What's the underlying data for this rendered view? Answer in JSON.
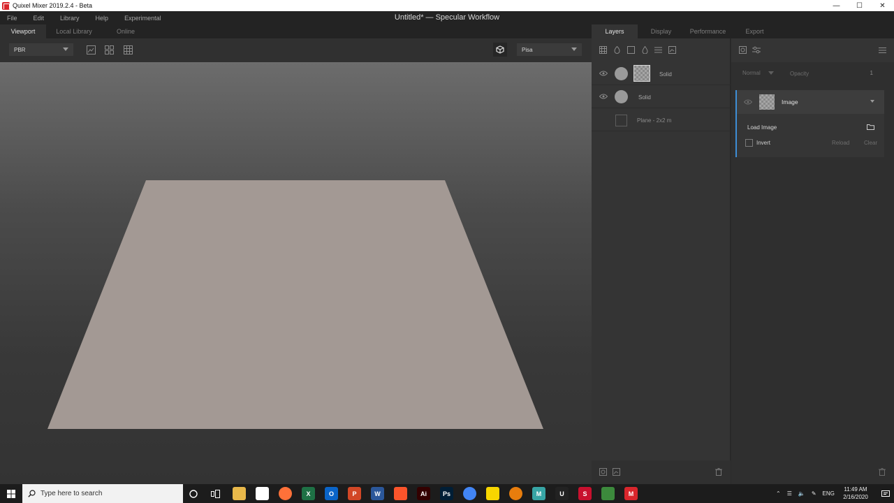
{
  "window": {
    "title": "Quixel Mixer 2019.2.4 - Beta",
    "document_title": "Untitled* — Specular Workflow",
    "controls": [
      "—",
      "☐",
      "✕"
    ]
  },
  "menu": {
    "items": [
      {
        "label": "File"
      },
      {
        "label": "Edit"
      },
      {
        "label": "Library"
      },
      {
        "label": "Help"
      },
      {
        "label": "Experimental"
      }
    ]
  },
  "left_tabs": [
    {
      "label": "Viewport",
      "active": true
    },
    {
      "label": "Local Library",
      "active": false
    },
    {
      "label": "Online",
      "active": false
    }
  ],
  "viewport": {
    "render_mode": "PBR",
    "environment": "Pisa",
    "plane_color": "#a39994"
  },
  "right_tabs": [
    {
      "label": "Layers",
      "active": true
    },
    {
      "label": "Display",
      "active": false
    },
    {
      "label": "Performance",
      "active": false
    },
    {
      "label": "Export",
      "active": false
    }
  ],
  "layers": {
    "rows": [
      {
        "label": "Solid",
        "has_checker": true
      },
      {
        "label": "Solid",
        "has_checker": false
      }
    ],
    "mesh": {
      "label": "Plane - 2x2 m"
    }
  },
  "properties": {
    "blend_mode": "Normal",
    "opacity_label": "Opacity",
    "opacity_value": "1",
    "image_card": {
      "title": "Image",
      "load_label": "Load Image",
      "invert_label": "Invert",
      "reload_label": "Reload",
      "clear_label": "Clear"
    }
  },
  "taskbar": {
    "search_placeholder": "Type here to search",
    "language": "ENG",
    "time": "11:49 AM",
    "date": "2/16/2020",
    "apps": [
      {
        "name": "file-explorer",
        "glyph": "",
        "color": "#e8b84a"
      },
      {
        "name": "store",
        "glyph": "",
        "color": "#ffffff"
      },
      {
        "name": "firefox",
        "glyph": "",
        "color": "#ff7139"
      },
      {
        "name": "excel",
        "glyph": "X",
        "color": "#1e7145"
      },
      {
        "name": "outlook",
        "glyph": "O",
        "color": "#0a64c8"
      },
      {
        "name": "powerpoint",
        "glyph": "P",
        "color": "#d24726"
      },
      {
        "name": "word",
        "glyph": "W",
        "color": "#2b579a"
      },
      {
        "name": "brave",
        "glyph": "",
        "color": "#fb542b"
      },
      {
        "name": "illustrator",
        "glyph": "Ai",
        "color": "#330000"
      },
      {
        "name": "photoshop",
        "glyph": "Ps",
        "color": "#001e36"
      },
      {
        "name": "chrome",
        "glyph": "",
        "color": "#4285f4"
      },
      {
        "name": "sticky-notes",
        "glyph": "",
        "color": "#f7d600"
      },
      {
        "name": "blender",
        "glyph": "",
        "color": "#e87d0d"
      },
      {
        "name": "maya",
        "glyph": "M",
        "color": "#37a5a5"
      },
      {
        "name": "unreal",
        "glyph": "U",
        "color": "#222222"
      },
      {
        "name": "substance",
        "glyph": "S",
        "color": "#c8102e"
      },
      {
        "name": "photos",
        "glyph": "",
        "color": "#3c8a3c"
      },
      {
        "name": "quixel-mixer",
        "glyph": "M",
        "color": "#d9262c"
      }
    ]
  }
}
